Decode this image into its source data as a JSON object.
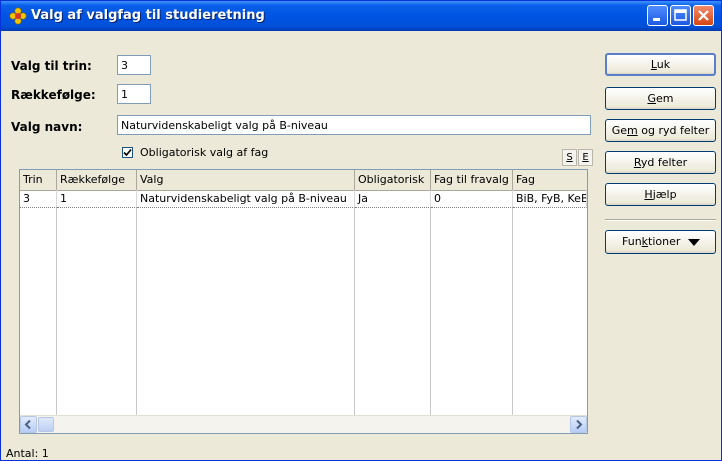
{
  "window": {
    "title": "Valg af valgfag til studieretning",
    "icon": "flower-icon",
    "controls": {
      "minimize": "minimize-icon",
      "maximize": "maximize-icon",
      "close": "close-icon"
    }
  },
  "form": {
    "trin_label": "Valg til trin:",
    "trin_value": "3",
    "raekkefolge_label": "Rækkefølge:",
    "raekkefolge_value": "1",
    "navn_label": "Valg navn:",
    "navn_value": "Naturvidenskabeligt valg på B-niveau",
    "obligatorisk_label": "Obligatorisk valg af fag",
    "obligatorisk_checked": true,
    "s_button": "S",
    "e_button": "E"
  },
  "grid": {
    "columns": [
      "Trin",
      "Rækkefølge",
      "Valg",
      "Obligatorisk",
      "Fag til fravalg",
      "Fag"
    ],
    "rows": [
      [
        "3",
        "1",
        "Naturvidenskabeligt valg på B-niveau",
        "Ja",
        "0",
        "BiB, FyB, KeB"
      ]
    ]
  },
  "status": {
    "text": "Antal: 1"
  },
  "buttons": {
    "luk": {
      "pre": "",
      "u": "L",
      "post": "uk"
    },
    "gem": {
      "pre": "",
      "u": "G",
      "post": "em"
    },
    "gem_ryd": {
      "pre": "Ge",
      "u": "m",
      "post": " og ryd felter"
    },
    "ryd": {
      "pre": "",
      "u": "R",
      "post": "yd felter"
    },
    "hjaelp": {
      "pre": "",
      "u": "H",
      "post": "jælp"
    },
    "funktioner": {
      "pre": "Fun",
      "u": "k",
      "post": "tioner"
    }
  },
  "colors": {
    "titlebar": "#0054e3",
    "window_bg": "#ece9d8",
    "border": "#7f9db9"
  }
}
